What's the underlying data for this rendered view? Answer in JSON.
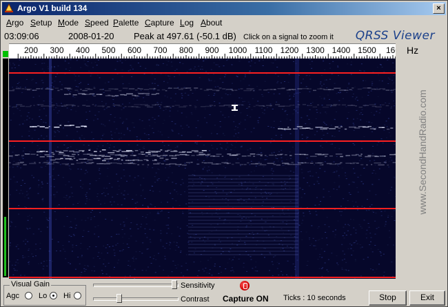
{
  "window": {
    "title": "Argo V1 build 134",
    "close_glyph": "×"
  },
  "menu": [
    {
      "label": "Argo",
      "ul": "A",
      "rest": "rgo"
    },
    {
      "label": "Setup",
      "ul": "S",
      "rest": "etup"
    },
    {
      "label": "Mode",
      "ul": "M",
      "rest": "ode"
    },
    {
      "label": "Speed",
      "ul": "S",
      "rest": "peed"
    },
    {
      "label": "Palette",
      "ul": "P",
      "rest": "alette"
    },
    {
      "label": "Capture",
      "ul": "C",
      "rest": "apture"
    },
    {
      "label": "Log",
      "ul": "L",
      "rest": "og"
    },
    {
      "label": "About",
      "ul": "A",
      "rest": "bout"
    }
  ],
  "status": {
    "time": "03:09:06",
    "date": "2008-01-20",
    "peak": "Peak at 497.61 (-50.1 dB)",
    "hint": "Click on a signal to zoom it",
    "brand": "QRSS Viewer"
  },
  "scale": {
    "labels": [
      "200",
      "300",
      "400",
      "500",
      "600",
      "700",
      "800",
      "900",
      "1000",
      "1100",
      "1200",
      "1300",
      "1400",
      "1500",
      "160"
    ],
    "unit": "Hz"
  },
  "watermark": "www.SecondHandRadio.com",
  "controls": {
    "visual_gain_label": "Visual Gain",
    "agc_label": "Agc",
    "lo_label": "Lo",
    "hi_label": "Hi",
    "selected_gain": "Lo",
    "sensitivity_label": "Sensitivity",
    "contrast_label": "Contrast",
    "sensitivity_level": 1.0,
    "contrast_level": 0.3,
    "capture_status": "Capture ON",
    "ticks": "Ticks  : 10 seconds",
    "stop_label": "Stop",
    "exit_label": "Exit"
  },
  "colors": {
    "accent_red": "#ff2020",
    "waterfall_bg": "#06072a",
    "brand_blue": "#1a3f8a"
  }
}
